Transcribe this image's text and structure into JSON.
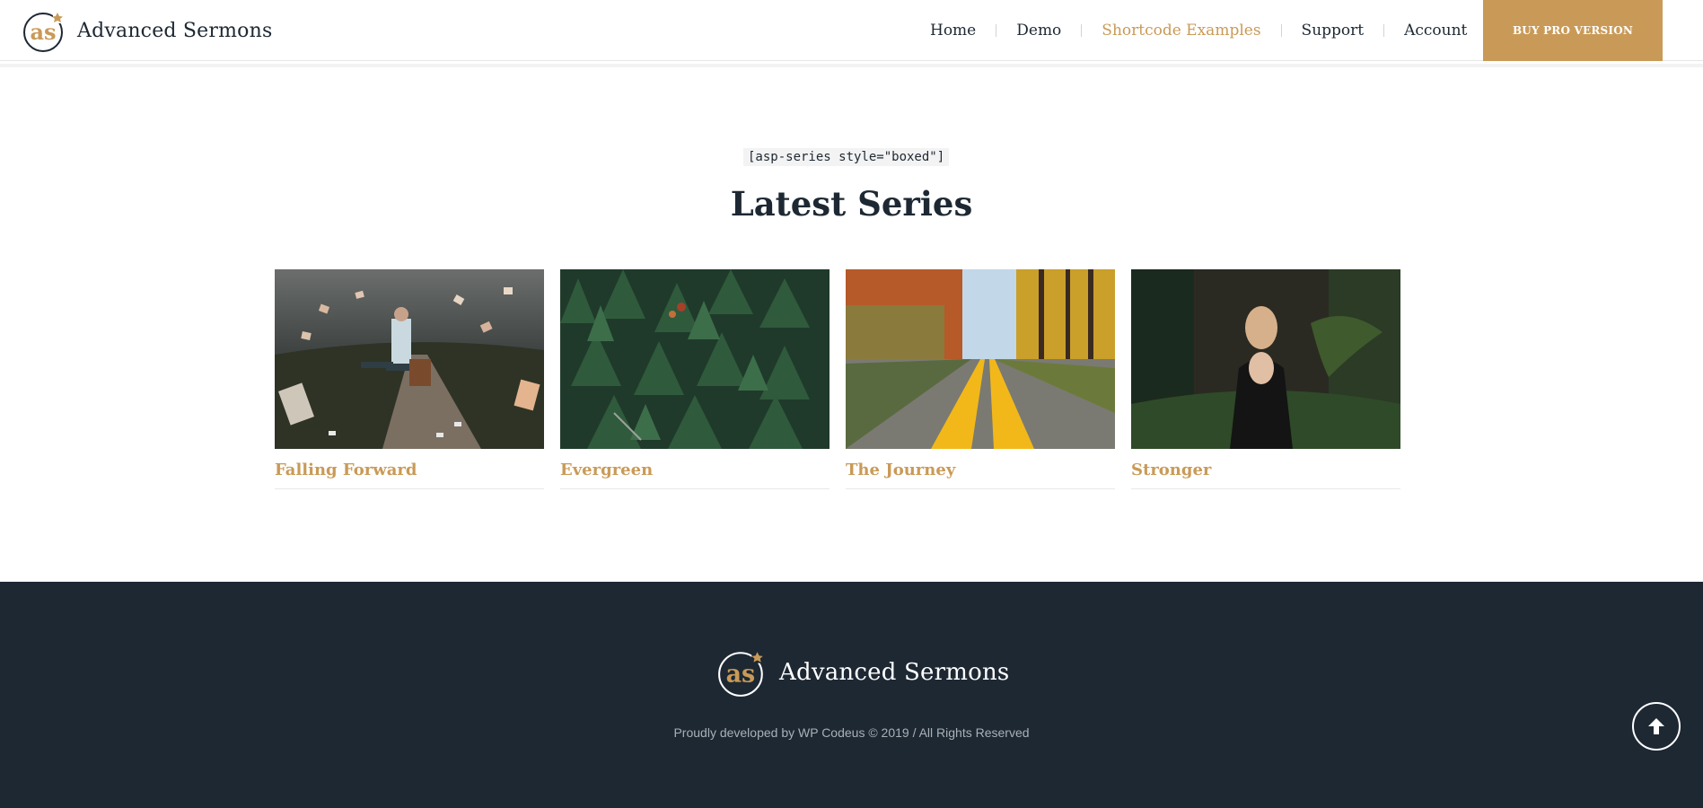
{
  "header": {
    "brand_name": "Advanced Sermons",
    "logo_letters": "as",
    "nav": [
      {
        "label": "Home",
        "active": false
      },
      {
        "label": "Demo",
        "active": false
      },
      {
        "label": "Shortcode Examples",
        "active": true
      },
      {
        "label": "Support",
        "active": false
      },
      {
        "label": "Account",
        "active": false
      }
    ],
    "buy_button": "BUY PRO VERSION"
  },
  "main": {
    "shortcode": "[asp-series style=\"boxed\"]",
    "title": "Latest Series",
    "series": [
      {
        "title": "Falling Forward"
      },
      {
        "title": "Evergreen"
      },
      {
        "title": "The Journey"
      },
      {
        "title": "Stronger"
      }
    ]
  },
  "footer": {
    "brand_name": "Advanced Sermons",
    "copyright": "Proudly developed by WP Codeus © 2019 / All Rights Reserved"
  },
  "colors": {
    "accent": "#c99a57",
    "dark": "#1d2833",
    "text": "#1d2833",
    "footer_text": "#a9b0b7"
  },
  "icons": {
    "logo": "advanced-sermons-logo-icon",
    "scroll_top": "arrow-up-icon"
  }
}
